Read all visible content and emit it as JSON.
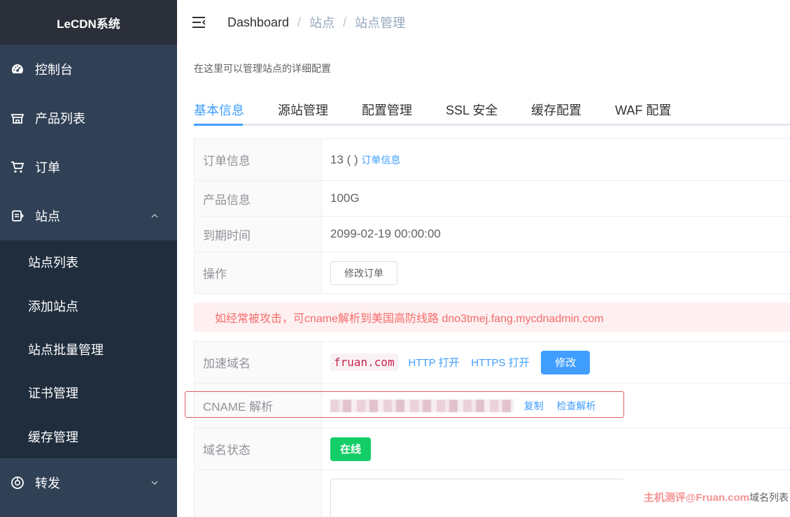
{
  "app": {
    "title": "LeCDN系统"
  },
  "sidebar": {
    "items": [
      {
        "label": "控制台",
        "icon": "dashboard-icon"
      },
      {
        "label": "产品列表",
        "icon": "store-icon"
      },
      {
        "label": "订单",
        "icon": "cart-icon"
      },
      {
        "label": "站点",
        "icon": "site-icon",
        "expanded": true
      },
      {
        "label": "转发",
        "icon": "forward-icon",
        "expanded": false
      }
    ],
    "site_submenu": [
      "站点列表",
      "添加站点",
      "站点批量管理",
      "证书管理",
      "缓存管理"
    ]
  },
  "header": {
    "breadcrumb": [
      "Dashboard",
      "站点",
      "站点管理"
    ],
    "separator": "/"
  },
  "main": {
    "description": "在这里可以管理站点的详细配置",
    "tabs": [
      "基本信息",
      "源站管理",
      "配置管理",
      "SSL 安全",
      "缓存配置",
      "WAF 配置"
    ],
    "active_tab": "基本信息",
    "order_table": {
      "order_label": "订单信息",
      "order_value": "13 ( )",
      "order_link": "订单信息",
      "product_label": "产品信息",
      "product_value": "100G",
      "expire_label": "到期时间",
      "expire_value": "2099-02-19 00:00:00",
      "action_label": "操作",
      "action_button": "修改订单"
    },
    "alert": "如经常被攻击，可cname解析到美国高防线路 dno3tmej.fang.mycdnadmin.com",
    "domain_table": {
      "domain_label": "加速域名",
      "domain_value": "fruan.com",
      "http_open": "HTTP 打开",
      "https_open": "HTTPS 打开",
      "edit_button": "修改",
      "cname_label": "CNAME 解析",
      "copy_link": "复制",
      "check_link": "检查解析",
      "status_label": "域名状态",
      "status_value": "在线"
    }
  },
  "watermark": {
    "text": "主机测评@Fruan.com",
    "tail": "域名列表"
  },
  "colors": {
    "sidebar_bg": "#304156",
    "submenu_bg": "#1f2d3d",
    "accent": "#409eff",
    "success": "#13ce66",
    "danger": "#f56c6c"
  }
}
